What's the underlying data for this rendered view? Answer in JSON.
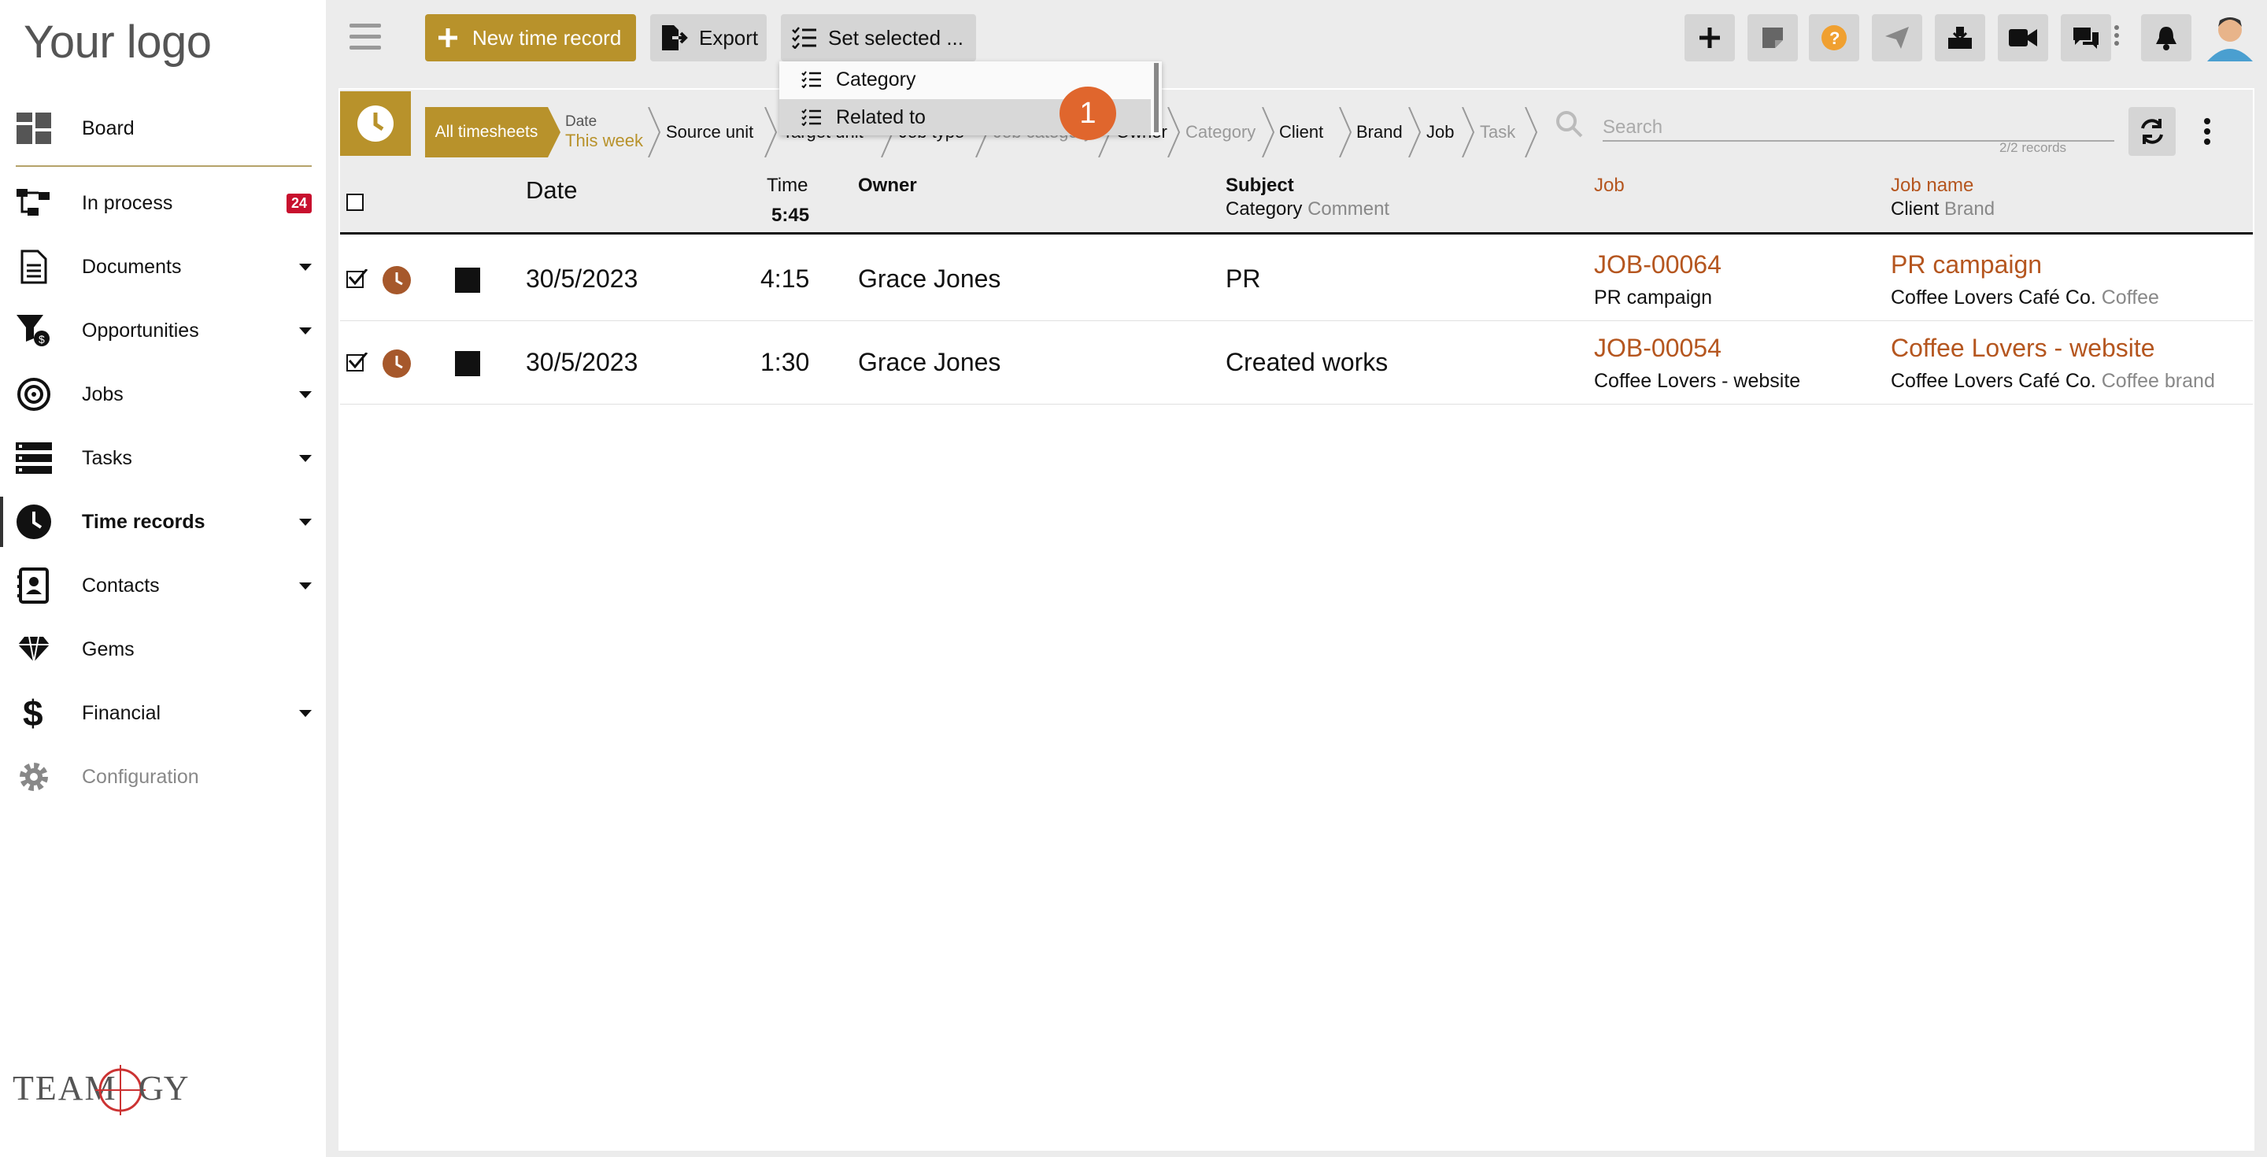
{
  "app": {
    "logo": "Your logo",
    "brand_mark": "TEAMOGY"
  },
  "sidebar": {
    "items": [
      {
        "label": "Board",
        "icon": "board-icon"
      },
      {
        "label": "In process",
        "icon": "process-icon",
        "badge": "24"
      },
      {
        "label": "Documents",
        "icon": "document-icon",
        "expandable": true
      },
      {
        "label": "Opportunities",
        "icon": "opportunities-icon",
        "expandable": true
      },
      {
        "label": "Jobs",
        "icon": "target-icon",
        "expandable": true
      },
      {
        "label": "Tasks",
        "icon": "tasks-icon",
        "expandable": true
      },
      {
        "label": "Time records",
        "icon": "clock-icon",
        "expandable": true,
        "active": true
      },
      {
        "label": "Contacts",
        "icon": "contacts-icon",
        "expandable": true
      },
      {
        "label": "Gems",
        "icon": "gem-icon"
      },
      {
        "label": "Financial",
        "icon": "dollar-icon",
        "expandable": true
      },
      {
        "label": "Configuration",
        "icon": "gear-icon",
        "muted": true
      }
    ]
  },
  "toolbar": {
    "new_label": "New time record",
    "export_label": "Export",
    "set_selected_label": "Set selected ..."
  },
  "dropdown": {
    "items": [
      "Category",
      "Related to"
    ],
    "step_badge": "1"
  },
  "filters": {
    "all_label": "All timesheets",
    "date_label": "Date",
    "date_value": "This week",
    "crumbs": [
      "Source unit",
      "Target unit",
      "Job type",
      "Job category",
      "Owner",
      "Category",
      "Client",
      "Brand",
      "Job",
      "Task"
    ],
    "search_placeholder": "Search",
    "records": "2/2 records"
  },
  "table": {
    "headers": {
      "date": "Date",
      "time": "Time",
      "time_total": "5:45",
      "owner": "Owner",
      "subject": "Subject",
      "category": "Category",
      "comment": "Comment",
      "job": "Job",
      "job_name": "Job name",
      "client": "Client",
      "brand": "Brand"
    },
    "rows": [
      {
        "date": "30/5/2023",
        "time": "4:15",
        "owner": "Grace Jones",
        "subject": "PR",
        "job": "JOB-00064",
        "job_sub": "PR campaign",
        "job_name": "PR campaign",
        "client": "Coffee Lovers Café Co.",
        "brand": "Coffee"
      },
      {
        "date": "30/5/2023",
        "time": "1:30",
        "owner": "Grace Jones",
        "subject": "Created works",
        "job": "JOB-00054",
        "job_sub": "Coffee Lovers - website",
        "job_name": "Coffee Lovers - website",
        "client": "Coffee Lovers Café Co.",
        "brand": "Coffee brand"
      }
    ]
  },
  "colors": {
    "accent": "#b8922b",
    "link": "#b5561f",
    "badge": "#c8102e",
    "step": "#e0662d"
  }
}
